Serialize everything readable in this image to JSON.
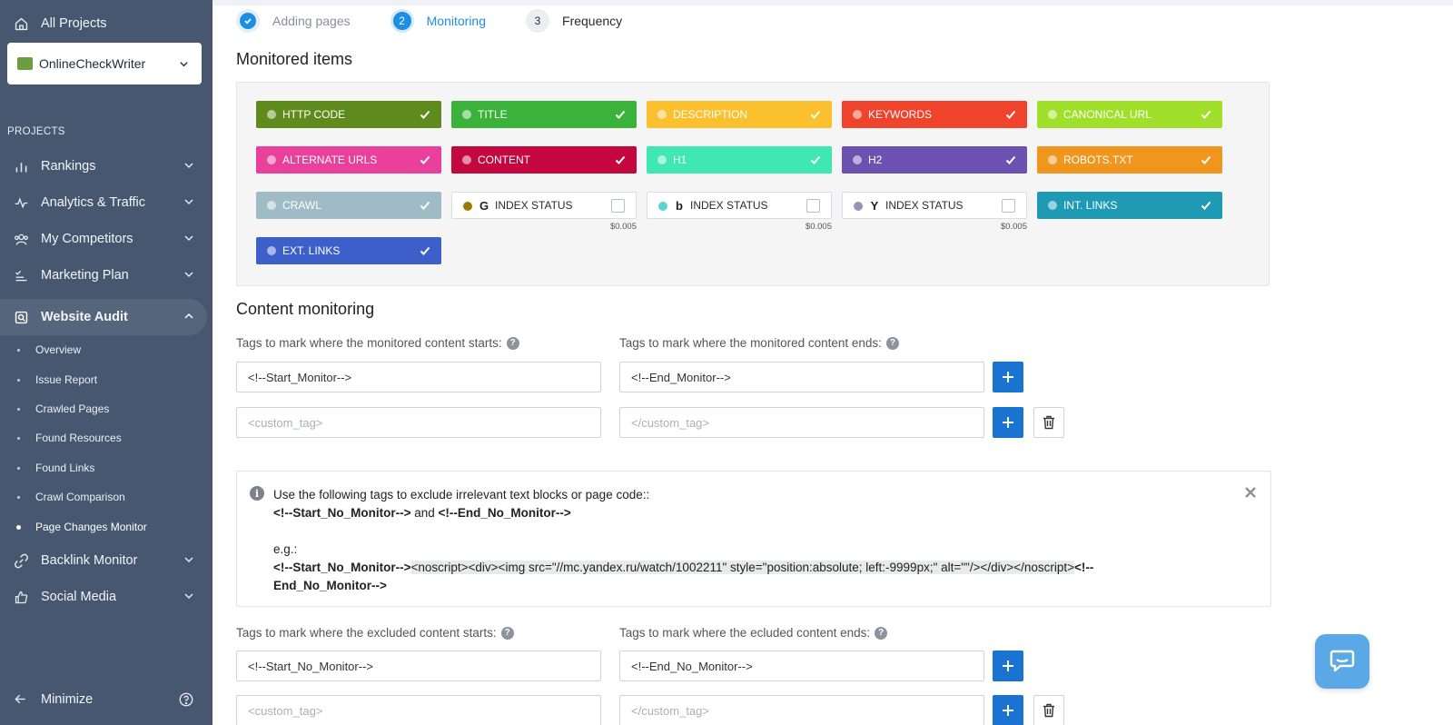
{
  "sidebar": {
    "all_projects": "All Projects",
    "project_name": "OnlineCheckWriter",
    "projects_heading": "PROJECTS",
    "nav": [
      {
        "label": "Rankings"
      },
      {
        "label": "Analytics & Traffic"
      },
      {
        "label": "My Competitors"
      },
      {
        "label": "Marketing Plan"
      },
      {
        "label": "Website Audit"
      },
      {
        "label": "Backlink Monitor"
      },
      {
        "label": "Social Media"
      }
    ],
    "sub_items": [
      {
        "label": "Overview"
      },
      {
        "label": "Issue Report"
      },
      {
        "label": "Crawled Pages"
      },
      {
        "label": "Found Resources"
      },
      {
        "label": "Found Links"
      },
      {
        "label": "Crawl Comparison"
      },
      {
        "label": "Page Changes Monitor"
      }
    ],
    "minimize": "Minimize"
  },
  "steps": [
    {
      "number": "",
      "label": "Adding pages",
      "state": "done"
    },
    {
      "number": "2",
      "label": "Monitoring",
      "state": "current"
    },
    {
      "number": "3",
      "label": "Frequency",
      "state": "todo"
    }
  ],
  "monitored": {
    "title": "Monitored items",
    "items": [
      {
        "label": "HTTP CODE",
        "color": "#5f8a1c",
        "checked": true
      },
      {
        "label": "TITLE",
        "color": "#3bb33a",
        "checked": true
      },
      {
        "label": "DESCRIPTION",
        "color": "#fbc02d",
        "checked": true
      },
      {
        "label": "KEYWORDS",
        "color": "#f0432c",
        "checked": true
      },
      {
        "label": "CANONICAL URL",
        "color": "#a0df2a",
        "checked": true
      },
      {
        "label": "ALTERNATE URLS",
        "color": "#e8409b",
        "checked": true
      },
      {
        "label": "CONTENT",
        "color": "#c4073f",
        "checked": true
      },
      {
        "label": "H1",
        "color": "#3ee8b0",
        "checked": true
      },
      {
        "label": "H2",
        "color": "#6c52b0",
        "checked": true
      },
      {
        "label": "ROBOTS.TXT",
        "color": "#f0951e",
        "checked": true
      },
      {
        "label": "CRAWL",
        "color": "#9fbcc6",
        "checked": true
      },
      {
        "label": "INDEX STATUS",
        "engine": "G",
        "dot_color": "#9a7b0a",
        "checked": false,
        "price": "$0.005"
      },
      {
        "label": "INDEX STATUS",
        "engine": "b",
        "dot_color": "#5bd4d0",
        "checked": false,
        "price": "$0.005"
      },
      {
        "label": "INDEX STATUS",
        "engine": "Y",
        "dot_color": "#9d8fb8",
        "checked": false,
        "price": "$0.005"
      },
      {
        "label": "INT. LINKS",
        "color": "#1f9ab5",
        "checked": true
      },
      {
        "label": "EXT. LINKS",
        "color": "#3d5fc9",
        "checked": true
      }
    ]
  },
  "content_monitoring": {
    "title": "Content monitoring",
    "start_label": "Tags to mark where the monitored content starts:",
    "end_label": "Tags to mark where the monitored content ends:",
    "start_value": "<!--Start_Monitor-->",
    "end_value": "<!--End_Monitor-->",
    "custom_start_placeholder": "<custom_tag>",
    "custom_end_placeholder": "</custom_tag>"
  },
  "info": {
    "line1": "Use the following tags to exclude irrelevant text blocks or page code::",
    "tag_start": "<!--Start_No_Monitor-->",
    "and": " and ",
    "tag_end": "<!--End_No_Monitor-->",
    "eg": "e.g.:",
    "example_start": "<!--Start_No_Monitor-->",
    "example_code": "<noscript><div><img src=\"//mc.yandex.ru/watch/1002211\" style=\"position:absolute; left:-9999px;\" alt=\"\"/></div></noscript>",
    "example_end_a": "<!--",
    "example_end_b": "End_No_Monitor-->"
  },
  "excluded": {
    "start_label": "Tags to mark where the excluded content starts:",
    "end_label": "Tags to mark where the ecluded content ends:",
    "start_value": "<!--Start_No_Monitor-->",
    "end_value": "<!--End_No_Monitor-->",
    "custom_start_placeholder": "<custom_tag>",
    "custom_end_placeholder": "</custom_tag>"
  }
}
